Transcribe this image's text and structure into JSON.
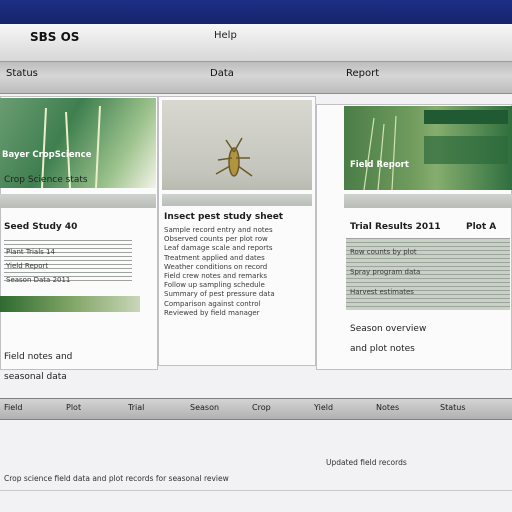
{
  "app": {
    "title": "SBS OS",
    "menu_label": "Help"
  },
  "nav": [
    "Status",
    "Data",
    "Report"
  ],
  "card1": {
    "image_tag": "Bayer CropScience",
    "caption": "Crop Science stats",
    "heading": "Seed Study 40",
    "lines": [
      "Plant Trials 14",
      "Yield Report",
      "Season Data 2011"
    ],
    "bottom": [
      "Field notes and",
      "seasonal data"
    ]
  },
  "card2": {
    "image_alt": "insect-on-leaf",
    "heading": "Insect pest study sheet",
    "lines": [
      "Sample record entry and notes",
      "Observed counts per plot row",
      "Leaf damage scale and reports",
      "Treatment applied and dates",
      "Weather conditions on record",
      "Field crew notes and remarks",
      "Follow up sampling schedule",
      "Summary of pest pressure data",
      "Comparison against control",
      "Reviewed by field manager"
    ]
  },
  "card3": {
    "image_tag": "Field Report",
    "heading": "Trial Results 2011",
    "side_heading": "Plot A",
    "lines": [
      "Row counts by plot",
      "Spray program data",
      "Harvest estimates"
    ],
    "bottom": [
      "Season overview",
      "and plot notes"
    ]
  },
  "table_tabs": [
    "Field",
    "Plot",
    "Trial",
    "Season",
    "Crop",
    "Yield",
    "Notes",
    "Status"
  ],
  "footer": {
    "left": "Crop science field data and plot records for seasonal review",
    "right": "Updated field records"
  },
  "colors": {
    "accent": "#16246b",
    "tag": "#b21a1a"
  }
}
